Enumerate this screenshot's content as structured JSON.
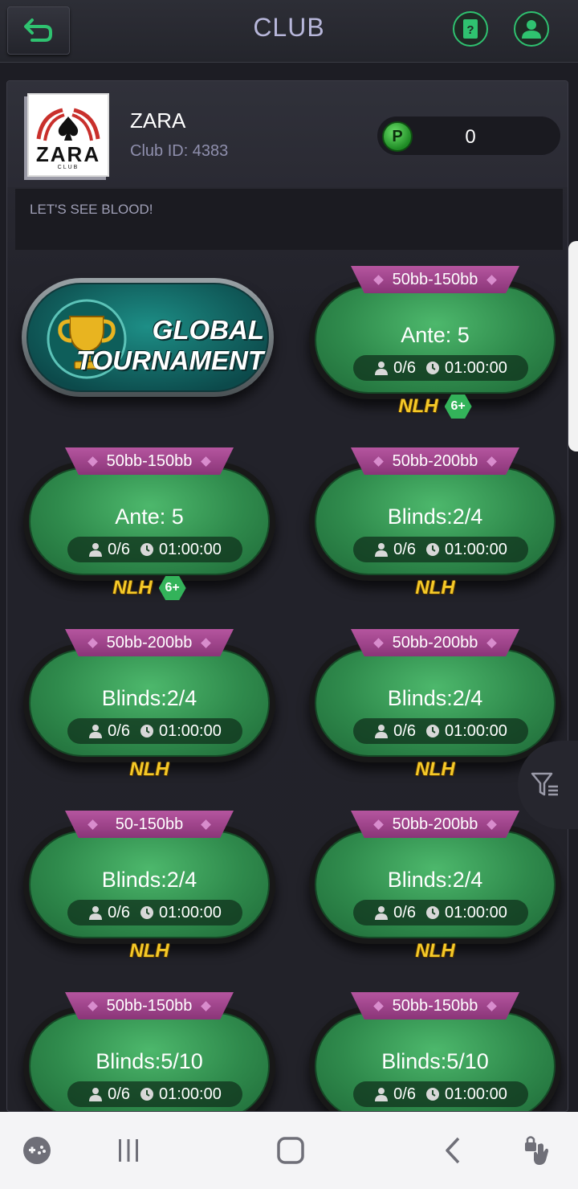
{
  "header": {
    "title": "CLUB",
    "back_icon": "back-arrow-icon",
    "help_icon": "help-card-icon",
    "members_icon": "member-icon"
  },
  "club": {
    "name": "ZARA",
    "id_label": "Club ID: 4383",
    "logo_text": "ZARA",
    "logo_subtext": "CLUB",
    "points_icon_label": "P",
    "points_value": "0",
    "notice": "LET'S SEE BLOOD!"
  },
  "tournament": {
    "line1": "GLOBAL",
    "line2": "TOURNAMENT"
  },
  "tables": [
    {
      "stakes": "50bb-150bb",
      "blinds": "Ante: 5",
      "players": "0/6",
      "time": "01:00:00",
      "game": "NLH",
      "badge": "6+"
    },
    {
      "stakes": "50bb-150bb",
      "blinds": "Ante: 5",
      "players": "0/6",
      "time": "01:00:00",
      "game": "NLH",
      "badge": "6+"
    },
    {
      "stakes": "50bb-200bb",
      "blinds": "Blinds:2/4",
      "players": "0/6",
      "time": "01:00:00",
      "game": "NLH",
      "badge": ""
    },
    {
      "stakes": "50bb-200bb",
      "blinds": "Blinds:2/4",
      "players": "0/6",
      "time": "01:00:00",
      "game": "NLH",
      "badge": ""
    },
    {
      "stakes": "50bb-200bb",
      "blinds": "Blinds:2/4",
      "players": "0/6",
      "time": "01:00:00",
      "game": "NLH",
      "badge": ""
    },
    {
      "stakes": "50-150bb",
      "blinds": "Blinds:2/4",
      "players": "0/6",
      "time": "01:00:00",
      "game": "NLH",
      "badge": ""
    },
    {
      "stakes": "50bb-200bb",
      "blinds": "Blinds:2/4",
      "players": "0/6",
      "time": "01:00:00",
      "game": "NLH",
      "badge": ""
    },
    {
      "stakes": "50bb-150bb",
      "blinds": "Blinds:5/10",
      "players": "0/6",
      "time": "01:00:00",
      "game": "",
      "badge": ""
    },
    {
      "stakes": "50bb-150bb",
      "blinds": "Blinds:5/10",
      "players": "0/6",
      "time": "01:00:00",
      "game": "",
      "badge": ""
    }
  ],
  "filter_icon": "filter-icon",
  "navbar": {
    "icons": [
      "game-tools-icon",
      "recent-apps-icon",
      "home-icon",
      "back-icon",
      "touch-lock-icon"
    ]
  },
  "colors": {
    "accent_green": "#2fc270",
    "felt_green": "#2f8a4c",
    "stakes_purple": "#a2468f",
    "nlh_gold": "#f5c928"
  }
}
